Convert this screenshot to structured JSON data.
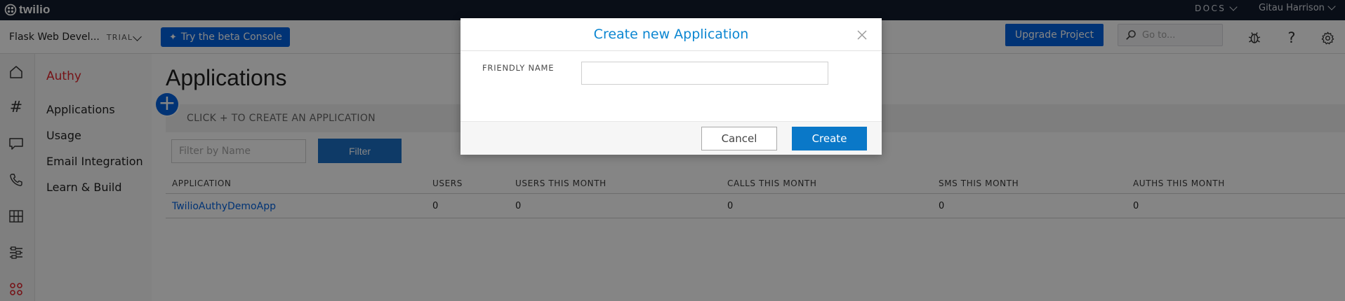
{
  "topbar": {
    "logo_text": "twilio",
    "logo_icon": "twilio-logo-icon",
    "docs_label": "DOCS",
    "user_name": "Gitau Harrison"
  },
  "projectbar": {
    "project_name": "Flask Web Devel...",
    "plan_badge": "TRIAL",
    "beta_button": "Try the beta Console",
    "upgrade_button": "Upgrade Project",
    "search_placeholder": "Go to...",
    "icons": [
      "debugger-bug-icon",
      "help-question-icon",
      "settings-gear-icon"
    ],
    "brand_color": "#0263e0"
  },
  "rail": {
    "icons": [
      "home-icon",
      "phone-numbers-hash-icon",
      "messaging-icon",
      "voice-icon",
      "studio-icon",
      "filters-icon",
      "authy-icon"
    ]
  },
  "subnav": {
    "section": "Authy",
    "section_color": "#e2252d",
    "items": [
      "Applications",
      "Usage",
      "Email Integration",
      "Learn & Build"
    ]
  },
  "main": {
    "title": "Applications",
    "add_symbol": "+",
    "hint": "CLICK + TO CREATE AN APPLICATION",
    "filter_placeholder": "Filter by Name",
    "filter_button": "Filter",
    "columns": [
      "APPLICATION",
      "USERS",
      "USERS THIS MONTH",
      "CALLS THIS MONTH",
      "SMS THIS MONTH",
      "AUTHS THIS MONTH"
    ],
    "rows": [
      [
        "TwilioAuthyDemoApp",
        "0",
        "0",
        "0",
        "0",
        "0"
      ]
    ]
  },
  "modal": {
    "title": "Create new Application",
    "field_label": "FRIENDLY NAME",
    "field_value": "",
    "cancel_button": "Cancel",
    "create_button": "Create",
    "title_color": "#0b86d1"
  }
}
